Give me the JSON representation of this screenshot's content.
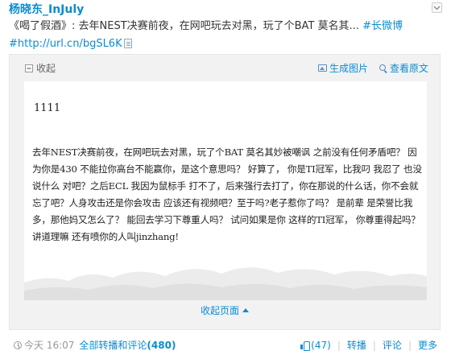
{
  "post": {
    "author": "杨晓东_InJuly",
    "text_prefix": "《喝了假酒》: 去年NEST决赛前夜，在网吧玩去对黑，玩了个BAT 莫名其... ",
    "hashtag": "#长微博",
    "link": "#http://url.cn/bgSL6K"
  },
  "card": {
    "collapse_top_label": "收起",
    "generate_image_label": "生成图片",
    "view_original_label": "查看原文",
    "title": "1111",
    "body": "去年NEST决赛前夜，在网吧玩去对黑，玩了个BAT  莫名其妙被嘲讽 之前没有任何矛盾吧？  因为你是430 不能拉你高台不能赢你，是这个意思吗？ 好算了，  你是TI冠军，比我叼 我忍了 也没说什么  对吧？之后ECL 我因为鼠标手 打不了，后来强行去打了，你在那说的什么话，你不会就忘了吧？人身攻击还是你会攻击  应该还有视频吧？至于吗?老子惹你了吗？  是前辈 是荣誉比我多，那他妈又怎么了？ 能回去学习下尊重人吗？ 试问如果是你 这样的TI冠军，  你尊重得起吗？ 讲道理嘛 还有喷你的人叫jinzhang!",
    "collapse_bottom_label": "收起页面"
  },
  "footer": {
    "time": "今天 16:07",
    "all_label": "全部转播和评论",
    "all_count": "(480)",
    "likes": "(47)",
    "repost": "转播",
    "comment": "评论",
    "more": "更多"
  },
  "colors": {
    "link": "#0a8cd2",
    "card_bg": "#f2f2f2"
  }
}
